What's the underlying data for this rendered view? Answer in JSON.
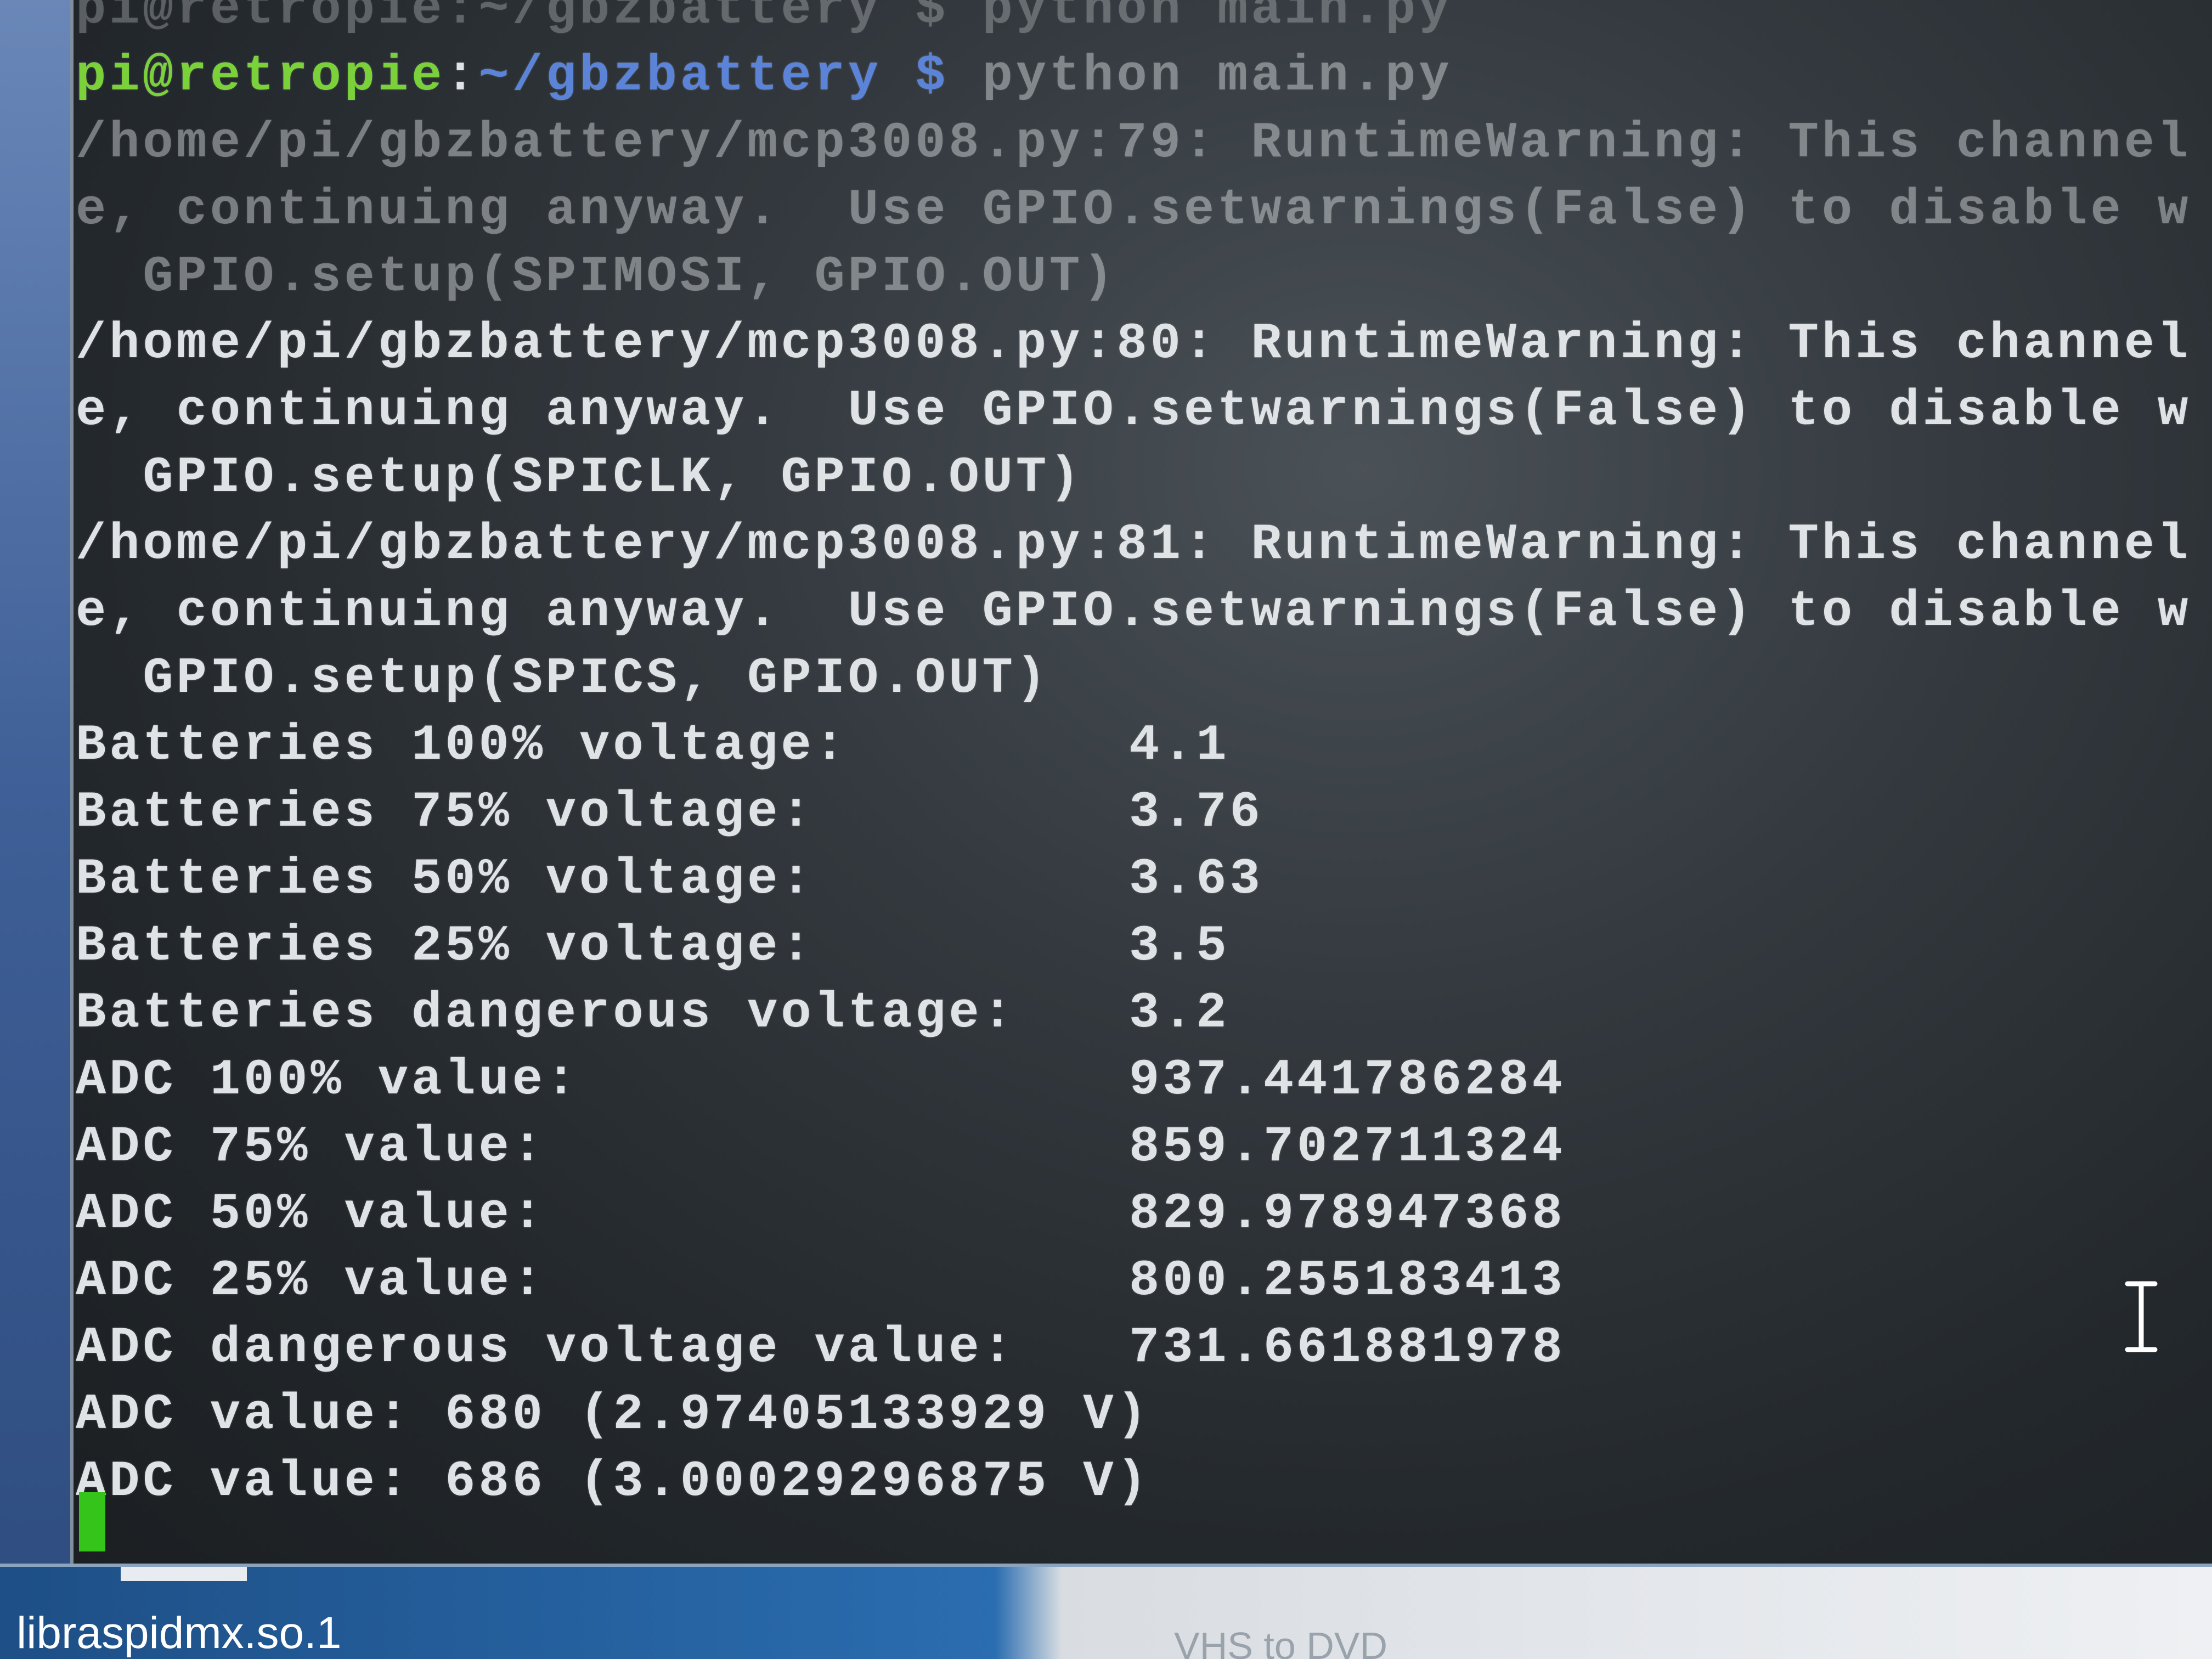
{
  "terminal": {
    "lines": [
      {
        "parts": [
          {
            "text": "pi@retropie:~/gbzbattery $ python main.py",
            "cls": "dimmer"
          }
        ]
      },
      {
        "parts": [
          {
            "text": "pi@retropie",
            "cls": "prompt-user"
          },
          {
            "text": ":",
            "cls": ""
          },
          {
            "text": "~/gbzbattery $",
            "cls": "prompt-path"
          },
          {
            "text": " python main.py",
            "cls": "dim"
          }
        ]
      },
      {
        "parts": [
          {
            "text": "/home/pi/gbzbattery/mcp3008.py:79: RuntimeWarning: This channel",
            "cls": "dim"
          }
        ]
      },
      {
        "parts": [
          {
            "text": "e, continuing anyway.  Use GPIO.setwarnings(False) to disable w",
            "cls": "dim"
          }
        ]
      },
      {
        "parts": [
          {
            "text": "  GPIO.setup(SPIMOSI, GPIO.OUT)",
            "cls": "dim"
          }
        ]
      },
      {
        "parts": [
          {
            "text": "/home/pi/gbzbattery/mcp3008.py:80: RuntimeWarning: This channel",
            "cls": ""
          }
        ]
      },
      {
        "parts": [
          {
            "text": "e, continuing anyway.  Use GPIO.setwarnings(False) to disable w",
            "cls": ""
          }
        ]
      },
      {
        "parts": [
          {
            "text": "  GPIO.setup(SPICLK, GPIO.OUT)",
            "cls": ""
          }
        ]
      },
      {
        "parts": [
          {
            "text": "/home/pi/gbzbattery/mcp3008.py:81: RuntimeWarning: This channel",
            "cls": ""
          }
        ]
      },
      {
        "parts": [
          {
            "text": "e, continuing anyway.  Use GPIO.setwarnings(False) to disable w",
            "cls": ""
          }
        ]
      },
      {
        "parts": [
          {
            "text": "  GPIO.setup(SPICS, GPIO.OUT)",
            "cls": ""
          }
        ]
      },
      {
        "label": "Batteries 100% voltage:",
        "value": "4.1"
      },
      {
        "label": "Batteries 75% voltage:",
        "value": "3.76"
      },
      {
        "label": "Batteries 50% voltage:",
        "value": "3.63"
      },
      {
        "label": "Batteries 25% voltage:",
        "value": "3.5"
      },
      {
        "label": "Batteries dangerous voltage:",
        "value": "3.2"
      },
      {
        "label": "ADC 100% value:",
        "value": "937.441786284"
      },
      {
        "label": "ADC 75% value:",
        "value": "859.702711324"
      },
      {
        "label": "ADC 50% value:",
        "value": "829.978947368"
      },
      {
        "label": "ADC 25% value:",
        "value": "800.255183413"
      },
      {
        "label": "ADC dangerous voltage value:",
        "value": "731.661881978"
      },
      {
        "parts": [
          {
            "text": "ADC value: 680 (2.97405133929 V)",
            "cls": ""
          }
        ]
      },
      {
        "parts": [
          {
            "text": "ADC value: 686 (3.00029296875 V)",
            "cls": ""
          }
        ]
      }
    ]
  },
  "taskbar": {
    "file_label": "libraspidmx.so.1",
    "right_label": "VHS to DVD"
  },
  "colors": {
    "prompt_user": "#7bd13a",
    "prompt_path": "#5b84d8",
    "cursor": "#35c41a",
    "text": "#dfe3e6"
  },
  "icons": {
    "cursor": "terminal-cursor-block",
    "mouse": "i-beam-cursor-icon"
  }
}
